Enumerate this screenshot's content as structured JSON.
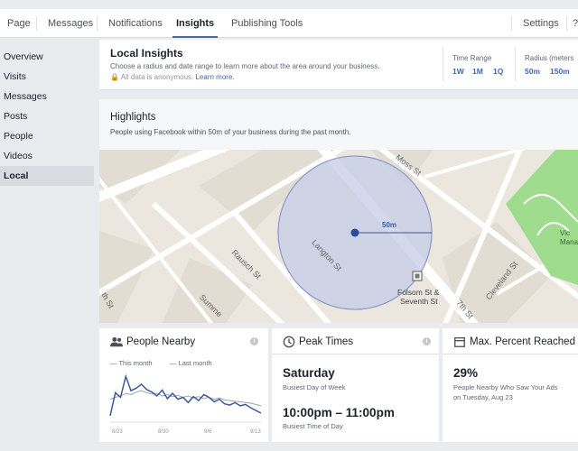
{
  "topnav": {
    "tabs": [
      "Page",
      "Messages",
      "Notifications",
      "Insights",
      "Publishing Tools"
    ],
    "active": "Insights",
    "settings": "Settings"
  },
  "sidebar": {
    "items": [
      "Overview",
      "Visits",
      "Messages",
      "Posts",
      "People",
      "Videos",
      "Local"
    ],
    "active": "Local"
  },
  "header": {
    "title": "Local Insights",
    "description": "Choose a radius and date range to learn more about the area around your business.",
    "anon_text": "All data is anonymous.",
    "learn_more": "Learn more.",
    "time_range": {
      "label": "Time Range",
      "options": [
        "1W",
        "1M",
        "1Q"
      ]
    },
    "radius": {
      "label": "Radius (meters",
      "options": [
        "50m",
        "150m"
      ]
    }
  },
  "highlights": {
    "title": "Highlights",
    "description": "People using Facebook within 50m of your business during the past month."
  },
  "map": {
    "streets": [
      "Moss St",
      "Langton St",
      "Rausch St",
      "Summe",
      "th St",
      "Cleveland St",
      "7th St"
    ],
    "radius_label": "50m",
    "business_label_1": "Folsom St &",
    "business_label_2": "Seventh St",
    "park_label_1": "Vic",
    "park_label_2": "Manalii",
    "park_color": "#9fdc8e",
    "circle_color": "#c6cce8"
  },
  "cards": {
    "people_nearby": {
      "title": "People Nearby",
      "legend_this": "This month",
      "legend_last": "Last month",
      "x_ticks": [
        "8/23",
        "8/30",
        "9/6",
        "9/13"
      ]
    },
    "peak_times": {
      "title": "Peak Times",
      "day_value": "Saturday",
      "day_caption": "Busiest Day of Week",
      "time_value": "10:00pm – 11:00pm",
      "time_caption": "Busiest Time of Day"
    },
    "max_percent": {
      "title": "Max. Percent Reached",
      "value": "29%",
      "caption_1": "People Nearby Who Saw Your Ads",
      "caption_2": "on Tuesday, Aug 23"
    }
  },
  "chart_data": {
    "type": "line",
    "title": "",
    "xlabel": "",
    "ylabel": "",
    "x_ticks": [
      "8/23",
      "8/30",
      "9/6",
      "9/13"
    ],
    "series": [
      {
        "name": "This month",
        "color": "#3b5998",
        "style": "solid",
        "values": [
          10,
          45,
          38,
          70,
          48,
          52,
          58,
          50,
          46,
          40,
          49,
          36,
          44,
          35,
          38,
          30,
          39,
          33,
          42,
          38,
          31,
          35,
          28,
          26,
          30,
          25,
          27,
          22,
          18,
          14
        ]
      },
      {
        "name": "Last month",
        "color": "#9aa3b3",
        "style": "solid",
        "values": [
          35,
          38,
          40,
          44,
          42,
          46,
          48,
          45,
          43,
          44,
          40,
          42,
          39,
          41,
          38,
          40,
          37,
          39,
          36,
          38,
          35,
          37,
          34,
          33,
          32,
          31,
          30,
          29,
          27,
          25
        ]
      }
    ],
    "ylim": [
      0,
      80
    ],
    "grid": false,
    "legend": "top"
  }
}
